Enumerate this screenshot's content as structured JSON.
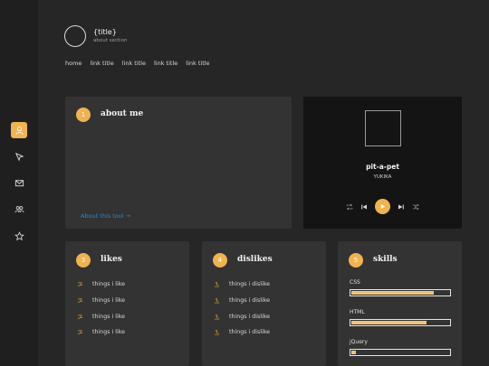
{
  "header": {
    "title": "{title}",
    "subtitle": "about section"
  },
  "nav": [
    "home",
    "link title",
    "link title",
    "link title",
    "link title"
  ],
  "sidebar": {
    "items": [
      {
        "icon": "user-icon",
        "active": true
      },
      {
        "icon": "cursor-icon",
        "active": false
      },
      {
        "icon": "mail-icon",
        "active": false
      },
      {
        "icon": "group-icon",
        "active": false
      },
      {
        "icon": "star-icon",
        "active": false
      }
    ]
  },
  "about": {
    "badge": "1",
    "title": "about me",
    "link": "About this tool →"
  },
  "player": {
    "song": "pit-a-pet",
    "artist": "YUKIKA"
  },
  "likes": {
    "badge": "3",
    "title": "likes",
    "items": [
      "things i like",
      "things i like",
      "things i like",
      "things i like"
    ]
  },
  "dislikes": {
    "badge": "4",
    "title": "dislikes",
    "items": [
      "things i dislike",
      "things i dislike",
      "things i dislike",
      "things i dislike"
    ]
  },
  "skills": {
    "badge": "5",
    "title": "skills",
    "items": [
      {
        "name": "CSS",
        "level": 0.84
      },
      {
        "name": "HTML",
        "level": 0.77
      },
      {
        "name": "jQuery",
        "level": 0.05
      }
    ]
  },
  "colors": {
    "accent": "#f0b34e",
    "background": "#262626",
    "card": "#333333",
    "link": "#2f83c8"
  }
}
